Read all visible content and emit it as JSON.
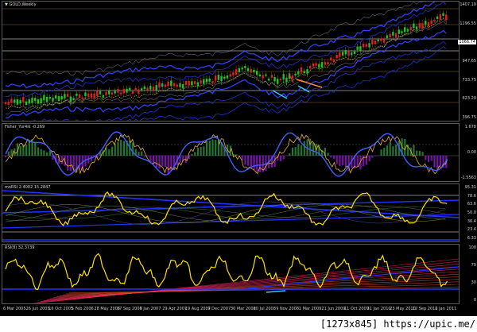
{
  "chart_window": {
    "symbol_label": "GOLD,Weekly",
    "symbol_marker": "▼"
  },
  "panes": {
    "main": {
      "label": "GOLD,Weekly",
      "price_axis": [
        "1407.10",
        "1296.55",
        "1066.74",
        "947.65",
        "733.75",
        "623.20",
        "396.75"
      ],
      "current_price": "1066.74"
    },
    "fisher": {
      "label": "Fisher_Yur4ik -0.269",
      "axis": [
        "1.678",
        "0.00",
        "-1.5563"
      ]
    },
    "rsi1": {
      "label": "mnRSI 2.4002 15.2847",
      "axis": [
        "95.31",
        "78.6",
        "63.6",
        "50.0",
        "36.4",
        "23.4",
        "6.33"
      ]
    },
    "rsi2": {
      "label": "RSI(8) 32.3739",
      "axis": [
        "100",
        "70",
        "30",
        "0"
      ]
    }
  },
  "time_axis": [
    "6 Mar 2005",
    "26 Jun 2005",
    "16 Oct 2005",
    "5 Feb 2006",
    "28 May 2006",
    "17 Sep 2006",
    "7 Jan 2007",
    "29 Apr 2007",
    "19 Aug 2007",
    "9 Dec 2007",
    "30 Mar 2008",
    "20 Jul 2008",
    "9 Nov 2008",
    "1 Mar 2009",
    "21 Jun 2009",
    "11 Oct 2009",
    "31 Jan 2010",
    "23 May 2010",
    "12 Sep 2010",
    "2 Jan 2011"
  ],
  "watermark": "[1273x845] https://upic.me/",
  "colors": {
    "background": "#000000",
    "bull_candle": "#22c322",
    "bear_candle": "#e02020",
    "rsi_line": "#ffe000",
    "fisher_line": "#4060ff",
    "annotation_arrow": "#33c8ff",
    "annotation_line": "#ff8a3a"
  }
}
